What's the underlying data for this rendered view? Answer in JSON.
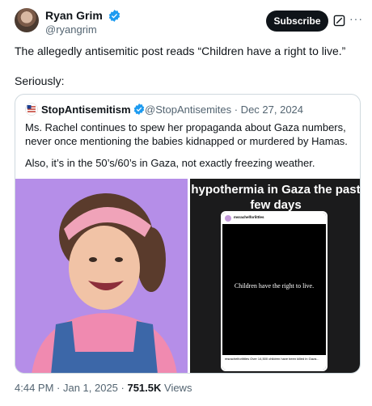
{
  "author": {
    "name": "Ryan Grim",
    "handle": "@ryangrim",
    "verified_color": "#1d9bf0"
  },
  "header_actions": {
    "subscribe_label": "Subscribe",
    "icons": [
      "grok-icon",
      "more-icon"
    ]
  },
  "tweet": {
    "text1": "The allegedly antisemitic post reads “Children have a right to live.”",
    "text2": "Seriously:"
  },
  "quote": {
    "name": "StopAntisemitism",
    "handle": "@StopAntisemites",
    "date": "Dec 27, 2024",
    "meta": "@StopAntisemites · Dec 27, 2024",
    "text1": "Ms. Rachel continues to spew her propaganda about Gaza numbers, never once mentioning the babies kidnapped or murdered by Hamas.",
    "text2": "Also, it’s in the 50’s/60’s in Gaza, not exactly freezing weather.",
    "image_right": {
      "title": "hypothermia in Gaza the past few days",
      "phone_user": "msrachelforlittles",
      "phone_message": "Children have the right to live.",
      "phone_caption": "msrachelforlittles Over 14,500 children have been killed in Gaza..."
    }
  },
  "footer": {
    "time": "4:44 PM · Jan 1, 2025 · ",
    "views_count": "751.5K",
    "views_label": " Views"
  },
  "colors": {
    "text_primary": "#0f1419",
    "text_secondary": "#536471",
    "border": "#cfd9de",
    "accent": "#1d9bf0",
    "left_image_bg": "#b58ee8",
    "right_image_bg": "#1b1b1c"
  }
}
